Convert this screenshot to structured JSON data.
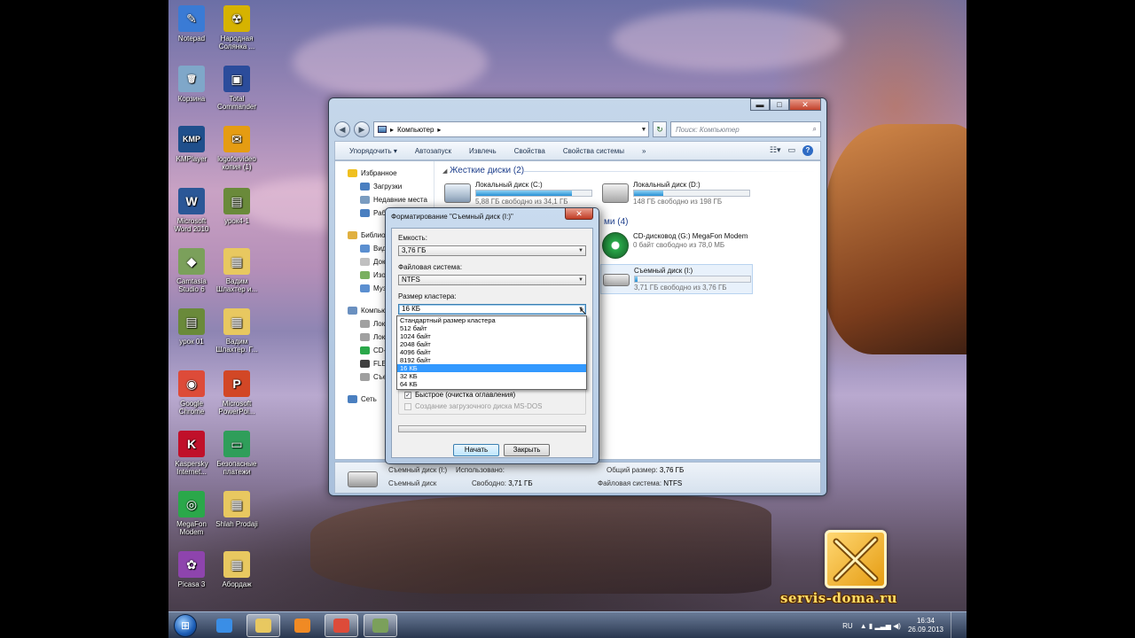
{
  "desktop_icons": [
    {
      "label": "Notepad",
      "color": "#3a7bd5",
      "glyph": "✎"
    },
    {
      "label": "Народная Солянка ...",
      "color": "#d6b300",
      "glyph": "☢"
    },
    {
      "label": "Корзина",
      "color": "#7fa7c9",
      "glyph": "🗑"
    },
    {
      "label": "Total Commander",
      "color": "#2b4c9b",
      "glyph": "▣"
    },
    {
      "label": "KMPlayer",
      "color": "#1f4f8c",
      "glyph": "KMP"
    },
    {
      "label": "logoforvideo копия (1)",
      "color": "#e59c12",
      "glyph": "✉"
    },
    {
      "label": "Microsoft Word 2010",
      "color": "#2b5797",
      "glyph": "W"
    },
    {
      "label": "урок4-1",
      "color": "#6a8a3a",
      "glyph": "▤"
    },
    {
      "label": "Camtasia Studio 6",
      "color": "#7ba05b",
      "glyph": "◆"
    },
    {
      "label": "Вадим Шлахтер и...",
      "color": "#e8c860",
      "glyph": "▦"
    },
    {
      "label": "урок 01",
      "color": "#6a8a3a",
      "glyph": "▤"
    },
    {
      "label": "Вадим Шлахтер. Г...",
      "color": "#e8c860",
      "glyph": "▦"
    },
    {
      "label": "Google Chrome",
      "color": "#dd4b39",
      "glyph": "◉"
    },
    {
      "label": "Microsoft PowerPoi...",
      "color": "#d24726",
      "glyph": "P"
    },
    {
      "label": "Kaspersky Internet...",
      "color": "#c0102a",
      "glyph": "K"
    },
    {
      "label": "Безопасные платежи",
      "color": "#2f9e5a",
      "glyph": "▭"
    },
    {
      "label": "MegaFon Modem",
      "color": "#2aa84a",
      "glyph": "◎"
    },
    {
      "label": "Shlah Prodaji",
      "color": "#e8c860",
      "glyph": "▦"
    },
    {
      "label": "Picasa 3",
      "color": "#8e44ad",
      "glyph": "✿"
    },
    {
      "label": "Абордаж",
      "color": "#e8c860",
      "glyph": "▦"
    }
  ],
  "explorer": {
    "window_buttons": {
      "minimize": "▬",
      "maximize": "□",
      "close": "✕"
    },
    "nav": {
      "back": "◀",
      "forward": "▶"
    },
    "address": {
      "crumb": "Компьютер",
      "sep": "▸"
    },
    "search_placeholder": "Поиск: Компьютер",
    "toolbar": [
      "Упорядочить ▾",
      "Автозапуск",
      "Извлечь",
      "Свойства",
      "Свойства системы",
      "»"
    ],
    "navpane": [
      {
        "label": "Избранное",
        "level": 0,
        "color": "#f0c020"
      },
      {
        "label": "Загрузки",
        "level": 1,
        "color": "#4a7fc0"
      },
      {
        "label": "Недавние места",
        "level": 1,
        "color": "#7a9cc0"
      },
      {
        "label": "Рабочий стол",
        "level": 1,
        "color": "#4a7fc0"
      },
      {
        "label": "Библиотеки",
        "level": 0,
        "color": "#e0b040",
        "gap": true
      },
      {
        "label": "Видео",
        "level": 1,
        "color": "#5b8fd0"
      },
      {
        "label": "Документы",
        "level": 1,
        "color": "#c0c0c0"
      },
      {
        "label": "Изображения",
        "level": 1,
        "color": "#7ab060"
      },
      {
        "label": "Музыка",
        "level": 1,
        "color": "#5b8fd0"
      },
      {
        "label": "Компьютер",
        "level": 0,
        "color": "#6a90c0",
        "gap": true
      },
      {
        "label": "Локальный диск (C:)",
        "level": 1,
        "color": "#a0a0a0"
      },
      {
        "label": "Локальный диск (D:)",
        "level": 1,
        "color": "#a0a0a0"
      },
      {
        "label": "CD-дисковод (G:)",
        "level": 1,
        "color": "#2aa84a"
      },
      {
        "label": "FLESH",
        "level": 1,
        "color": "#404040"
      },
      {
        "label": "Съемный диск (I:)",
        "level": 1,
        "color": "#a0a0a0"
      },
      {
        "label": "Сеть",
        "level": 0,
        "color": "#4a7fc0",
        "gap": true
      }
    ],
    "groups": {
      "hdd": "Жесткие диски (2)",
      "removable": "Устройства со съемными носителями (4)",
      "removable_visible_tail": "ми (4)"
    },
    "drives": {
      "c": {
        "name": "Локальный диск (C:)",
        "free": "5,88 ГБ свободно из 34,1 ГБ",
        "used_fraction": 0.83
      },
      "d": {
        "name": "Локальный диск (D:)",
        "free": "148 ГБ свободно из 198 ГБ",
        "used_fraction": 0.25
      },
      "g": {
        "name": "CD-дисковод (G:) MegaFon Modem",
        "free": "0 байт свободно из 78,0 МБ"
      },
      "i": {
        "name": "Съемный диск (I:)",
        "free": "3,71 ГБ свободно из 3,76 ГБ",
        "used_fraction": 0.02
      }
    },
    "details": {
      "name": "Съемный диск (I:)",
      "type": "Съемный диск",
      "used_label": "Использовано:",
      "free_label": "Свободно:",
      "free_value": "3,71 ГБ",
      "total_label": "Общий размер:",
      "total_value": "3,76 ГБ",
      "fs_label": "Файловая система:",
      "fs_value": "NTFS"
    }
  },
  "format_dialog": {
    "title": "Форматирование \"Съемный диск (I:)\"",
    "close": "✕",
    "capacity_label": "Емкость:",
    "capacity_value": "3,76 ГБ",
    "fs_label": "Файловая система:",
    "fs_value": "NTFS",
    "cluster_label": "Размер кластера:",
    "cluster_value": "16 КБ",
    "cluster_options": [
      "Стандартный размер кластера",
      "512 байт",
      "1024 байт",
      "2048 байт",
      "4096 байт",
      "8192 байт",
      "16 КБ",
      "32 КБ",
      "64 КБ"
    ],
    "cluster_selected_index": 6,
    "quick_format": "Быстрое (очистка оглавления)",
    "quick_checked": "✓",
    "msdos": "Создание загрузочного диска MS-DOS",
    "start_button": "Начать",
    "close_button": "Закрыть",
    "dropdown_arrow": "▼"
  },
  "taskbar": {
    "start_glyph": "⊞",
    "apps": [
      {
        "name": "ie",
        "color": "#3a8ee6",
        "active": false
      },
      {
        "name": "explorer",
        "color": "#e8c860",
        "active": true
      },
      {
        "name": "media",
        "color": "#f08a24",
        "active": false
      },
      {
        "name": "chrome",
        "color": "#dd4b39",
        "active": true
      },
      {
        "name": "camtasia",
        "color": "#7ba05b",
        "active": true
      }
    ],
    "lang": "RU",
    "tray_glyphs": "▲ ▮ ▂▃▅ ◀)",
    "time": "16:34",
    "date": "26.09.2013"
  },
  "watermark": "servis-doma.ru"
}
